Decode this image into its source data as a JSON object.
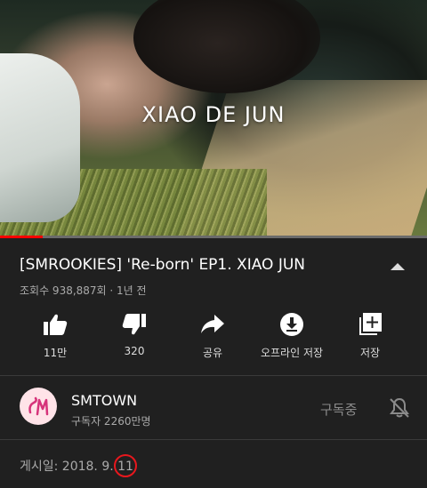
{
  "player": {
    "overlay_title": "XIAO DE JUN",
    "progress_fraction": 0.1,
    "progress_color": "#ff0000"
  },
  "video": {
    "title": "[SMROOKIES] 'Re-born' EP1. XIAO JUN",
    "meta": "조회수 938,887회 · 1년 전",
    "collapse_icon": "chevron-up-icon"
  },
  "actions": [
    {
      "icon": "thumbs-up-icon",
      "label": "11만"
    },
    {
      "icon": "thumbs-down-icon",
      "label": "320"
    },
    {
      "icon": "share-icon",
      "label": "공유"
    },
    {
      "icon": "download-icon",
      "label": "오프라인 저장"
    },
    {
      "icon": "add-to-playlist-icon",
      "label": "저장"
    }
  ],
  "channel": {
    "name": "SMTOWN",
    "subscribers": "구독자 2260만명",
    "subscribe_state": "구독중",
    "bell_icon": "bell-off-icon",
    "avatar_icon": "smtown-logo-icon"
  },
  "description": {
    "published": "게시일: 2018. 9. 11."
  },
  "colors": {
    "background": "#202020",
    "annotation_circle": "#e8171d"
  }
}
